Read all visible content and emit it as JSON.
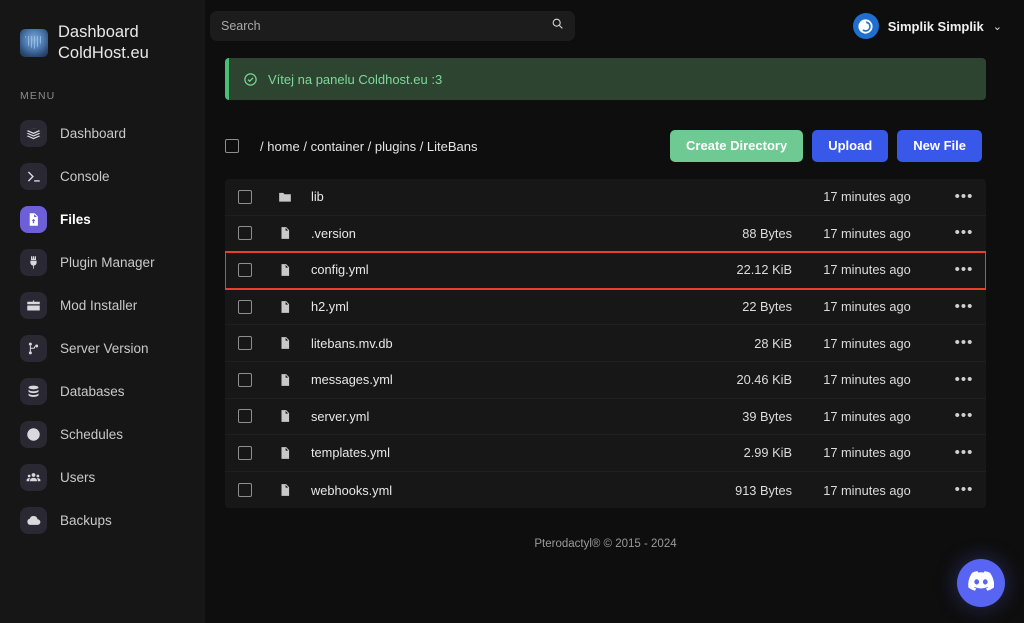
{
  "sidebar": {
    "brand": {
      "line1": "Dashboard",
      "line2": "ColdHost.eu",
      "logo_icon": "coldhost-logo-icon"
    },
    "menu_label": "MENU",
    "items": [
      {
        "label": "Dashboard",
        "icon": "layers-icon",
        "active": false
      },
      {
        "label": "Console",
        "icon": "terminal-icon",
        "active": false
      },
      {
        "label": "Files",
        "icon": "file-icon",
        "active": true
      },
      {
        "label": "Plugin Manager",
        "icon": "plug-icon",
        "active": false
      },
      {
        "label": "Mod Installer",
        "icon": "box-icon",
        "active": false
      },
      {
        "label": "Server Version",
        "icon": "branch-icon",
        "active": false
      },
      {
        "label": "Databases",
        "icon": "database-icon",
        "active": false
      },
      {
        "label": "Schedules",
        "icon": "clock-icon",
        "active": false
      },
      {
        "label": "Users",
        "icon": "users-icon",
        "active": false
      },
      {
        "label": "Backups",
        "icon": "cloud-icon",
        "active": false
      }
    ]
  },
  "topbar": {
    "search": {
      "placeholder": "Search",
      "value": "",
      "icon": "search-icon"
    },
    "user": {
      "name": "Simplik Simplik",
      "avatar_icon": "power-avatar-icon",
      "caret_icon": "chevron-down-icon"
    }
  },
  "banner": {
    "text": "Vítej na panelu Coldhost.eu :3",
    "icon": "check-circle-icon",
    "accent_color": "#4cc072"
  },
  "files_panel": {
    "breadcrumb": "/ home / container / plugins / LiteBans",
    "select_all_checkbox": false,
    "buttons": [
      {
        "label": "Create Directory",
        "style": "green",
        "color": "#6ec993"
      },
      {
        "label": "Upload",
        "style": "blue",
        "color": "#3758e8"
      },
      {
        "label": "New File",
        "style": "blue",
        "color": "#3758e8"
      }
    ],
    "rows": [
      {
        "name": "lib",
        "icon": "folder-icon",
        "size": "",
        "modified": "17 minutes ago",
        "highlight": false
      },
      {
        "name": ".version",
        "icon": "file-icon",
        "size": "88 Bytes",
        "modified": "17 minutes ago",
        "highlight": false
      },
      {
        "name": "config.yml",
        "icon": "file-icon",
        "size": "22.12 KiB",
        "modified": "17 minutes ago",
        "highlight": true
      },
      {
        "name": "h2.yml",
        "icon": "file-icon",
        "size": "22 Bytes",
        "modified": "17 minutes ago",
        "highlight": false
      },
      {
        "name": "litebans.mv.db",
        "icon": "file-icon",
        "size": "28 KiB",
        "modified": "17 minutes ago",
        "highlight": false
      },
      {
        "name": "messages.yml",
        "icon": "file-icon",
        "size": "20.46 KiB",
        "modified": "17 minutes ago",
        "highlight": false
      },
      {
        "name": "server.yml",
        "icon": "file-icon",
        "size": "39 Bytes",
        "modified": "17 minutes ago",
        "highlight": false
      },
      {
        "name": "templates.yml",
        "icon": "file-icon",
        "size": "2.99 KiB",
        "modified": "17 minutes ago",
        "highlight": false
      },
      {
        "name": "webhooks.yml",
        "icon": "file-icon",
        "size": "913 Bytes",
        "modified": "17 minutes ago",
        "highlight": false
      }
    ],
    "row_menu_glyph": "•••"
  },
  "footer": {
    "text": "Pterodactyl® © 2015 - 2024"
  },
  "discord_button": {
    "icon": "discord-icon",
    "color": "#5865f2"
  },
  "highlight_color": "#e8402a"
}
